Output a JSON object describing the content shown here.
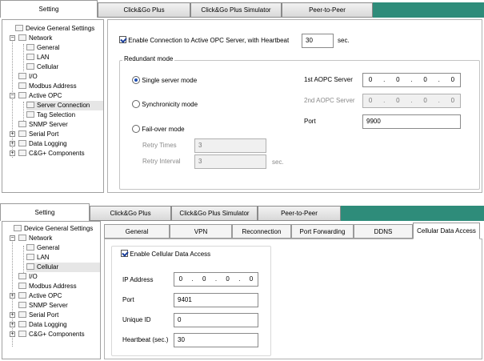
{
  "panel1": {
    "tabs": [
      "Setting",
      "Click&Go Plus",
      "Click&Go Plus Simulator",
      "Peer-to-Peer"
    ],
    "tree": {
      "device_general": "Device General Settings",
      "network": "Network",
      "general": "General",
      "lan": "LAN",
      "cellular": "Cellular",
      "io": "I/O",
      "modbus": "Modbus Address",
      "active_opc": "Active OPC",
      "server_connection": "Server Connection",
      "tag_selection": "Tag Selection",
      "snmp": "SNMP Server",
      "serial_port": "Serial Port",
      "data_logging": "Data Logging",
      "cg_components": "C&G+ Components",
      "expand_minus": "−",
      "expand_plus": "+"
    },
    "enable_label": "Enable Connection to Active OPC Server, with Heartbeat",
    "heartbeat_value": "30",
    "heartbeat_unit": "sec.",
    "redundant_title": "Redundant mode",
    "single_label": "Single server mode",
    "sync_label": "Synchronicity mode",
    "failover_label": "Fail-over mode",
    "aopc1_label": "1st  AOPC Server",
    "aopc1_ip": [
      "0",
      "0",
      "0",
      "0"
    ],
    "aopc2_label": "2nd AOPC Server",
    "aopc2_ip": [
      "0",
      "0",
      "0",
      "0"
    ],
    "port_label": "Port",
    "port_value": "9900",
    "retry_times_label": "Retry Times",
    "retry_times_value": "3",
    "retry_interval_label": "Retry Interval",
    "retry_interval_value": "3",
    "retry_interval_unit": "sec."
  },
  "panel2": {
    "tabs": [
      "Setting",
      "Click&Go Plus",
      "Click&Go Plus Simulator",
      "Peer-to-Peer"
    ],
    "tree": {
      "device_general": "Device General Settings",
      "network": "Network",
      "general": "General",
      "lan": "LAN",
      "cellular": "Cellular",
      "io": "I/O",
      "modbus": "Modbus Address",
      "active_opc": "Active OPC",
      "snmp": "SNMP Server",
      "serial_port": "Serial Port",
      "data_logging": "Data Logging",
      "cg_components": "C&G+ Components",
      "expand_minus": "−",
      "expand_plus": "+"
    },
    "subtabs": [
      "General",
      "VPN",
      "Reconnection",
      "Port Forwarding",
      "DDNS",
      "Cellular Data Access"
    ],
    "enable_label": "Enable Cellular Data Access",
    "ip_label": "IP Address",
    "ip_value": [
      "0",
      "0",
      "0",
      "0"
    ],
    "port_label": "Port",
    "port_value": "9401",
    "unique_label": "Unique ID",
    "unique_value": "0",
    "heartbeat_label": "Heartbeat (sec.)",
    "heartbeat_value": "30"
  },
  "ip_dot": "."
}
